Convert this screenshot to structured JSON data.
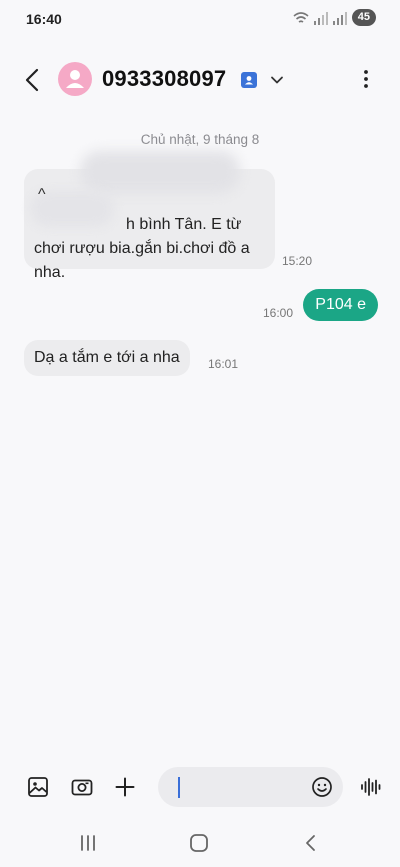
{
  "status_bar": {
    "time": "16:40",
    "battery": "45"
  },
  "header": {
    "contact_name": "0933308097",
    "avatar_color": "#f5a9c6"
  },
  "conversation": {
    "date_separator": "Chủ nhật, 9 tháng 8",
    "messages": [
      {
        "direction": "incoming",
        "text_top_visible": "^",
        "text": "h bình Tân. E từ chơi rượu bia.gắn bi.chơi đồ a nha.",
        "time": "15:20"
      },
      {
        "direction": "outgoing",
        "text": "P104 e",
        "time": "16:00"
      },
      {
        "direction": "incoming",
        "text": "Dạ a tắm e tới a nha",
        "time": "16:01"
      }
    ]
  },
  "composer": {
    "input_value": ""
  },
  "colors": {
    "outgoing_bubble": "#1ba686",
    "incoming_bubble": "#ececee",
    "background": "#f8f8fa",
    "caret": "#3a6fd8"
  },
  "icons": {
    "back": "back-arrow-icon",
    "contact_card": "contact-card-icon",
    "expand": "chevron-down-icon",
    "more": "more-vertical-icon",
    "gallery": "gallery-icon",
    "camera": "camera-icon",
    "add": "plus-icon",
    "emoji": "emoji-icon",
    "voice": "voice-waveform-icon",
    "nav_recents": "recents-icon",
    "nav_home": "home-icon",
    "nav_back": "nav-back-icon"
  }
}
